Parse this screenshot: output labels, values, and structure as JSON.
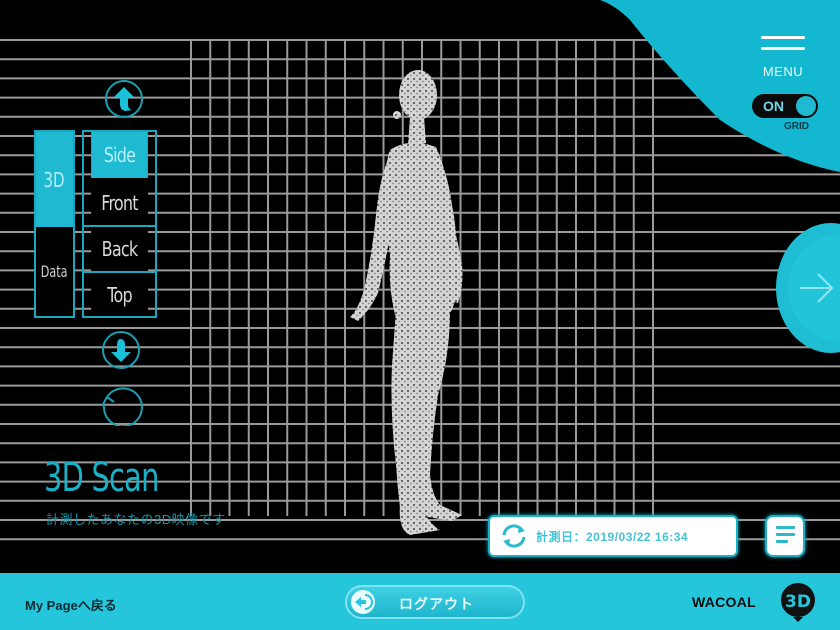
{
  "header": {
    "menu_label": "MENU",
    "grid_toggle": {
      "state_label": "ON",
      "caption": "GRID",
      "enabled": true
    }
  },
  "view_controls": {
    "mode_tabs": [
      {
        "label": "3D",
        "active": true
      },
      {
        "label": "Data",
        "active": false
      }
    ],
    "angle_tabs": [
      {
        "label": "Side",
        "active": true
      },
      {
        "label": "Front",
        "active": false
      },
      {
        "label": "Back",
        "active": false
      },
      {
        "label": "Top",
        "active": false
      }
    ],
    "icons": {
      "up": "arrow-up-icon",
      "down": "arrow-down-icon",
      "rotate": "rotate-icon"
    }
  },
  "scan_info": {
    "title": "3D Scan",
    "subtitle": "計測したあなたの3D映像です",
    "measured_label": "計測日：2019/03/22 16:34"
  },
  "footer": {
    "back_link": "My Pageへ戻る",
    "logout_label": "ログアウト",
    "brand_name": "WACOAL"
  },
  "colors": {
    "accent": "#25c5dc",
    "accent_dark": "#18a9bf",
    "background": "#000000",
    "grid_line": "#9a9a9a"
  }
}
